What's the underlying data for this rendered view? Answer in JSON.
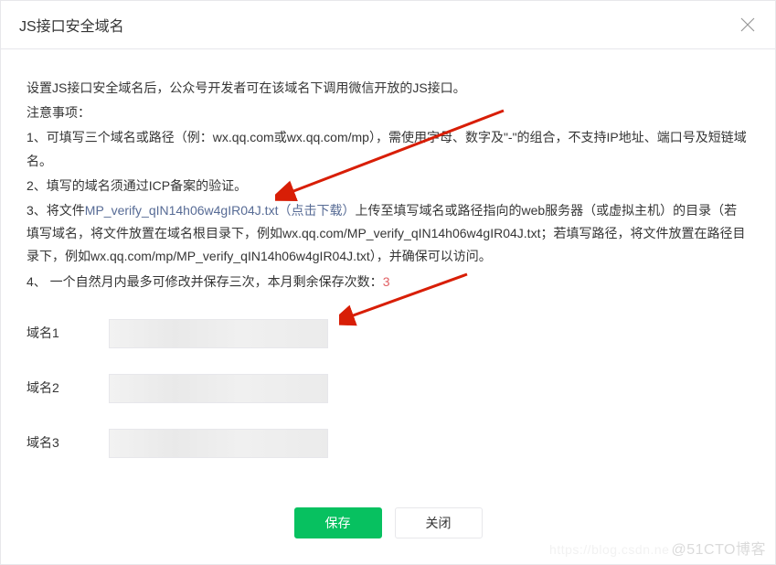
{
  "header": {
    "title": "JS接口安全域名"
  },
  "instructions": {
    "intro": "设置JS接口安全域名后，公众号开发者可在该域名下调用微信开放的JS接口。",
    "notice_heading": "注意事项：",
    "item1": "1、可填写三个域名或路径（例：wx.qq.com或wx.qq.com/mp），需使用字母、数字及\"-\"的组合，不支持IP地址、端口号及短链域名。",
    "item2": "2、填写的域名须通过ICP备案的验证。",
    "item3_prefix": "3、将文件",
    "file_name": "MP_verify_qIN14h06w4gIR04J.txt",
    "download_text": "（点击下载）",
    "item3_mid": "上传至填写域名或路径指向的web服务器（或虚拟主机）的目录（若填写域名，将文件放置在域名根目录下，例如wx.qq.com/MP_verify_qIN14h06w4gIR04J.txt；若填写路径，将文件放置在路径目录下，例如wx.qq.com/mp/MP_verify_qIN14h06w4gIR04J.txt），并确保可以访问。",
    "item4_prefix": "4、 一个自然月内最多可修改并保存三次，本月剩余保存次数：",
    "remaining_count": "3"
  },
  "form": {
    "rows": [
      {
        "label": "域名1",
        "value": ""
      },
      {
        "label": "域名2",
        "value": ""
      },
      {
        "label": "域名3",
        "value": ""
      }
    ]
  },
  "footer": {
    "save_label": "保存",
    "close_label": "关闭"
  },
  "watermark": {
    "left": "https://blog.csdn.ne",
    "right": "@51CTO博客"
  }
}
